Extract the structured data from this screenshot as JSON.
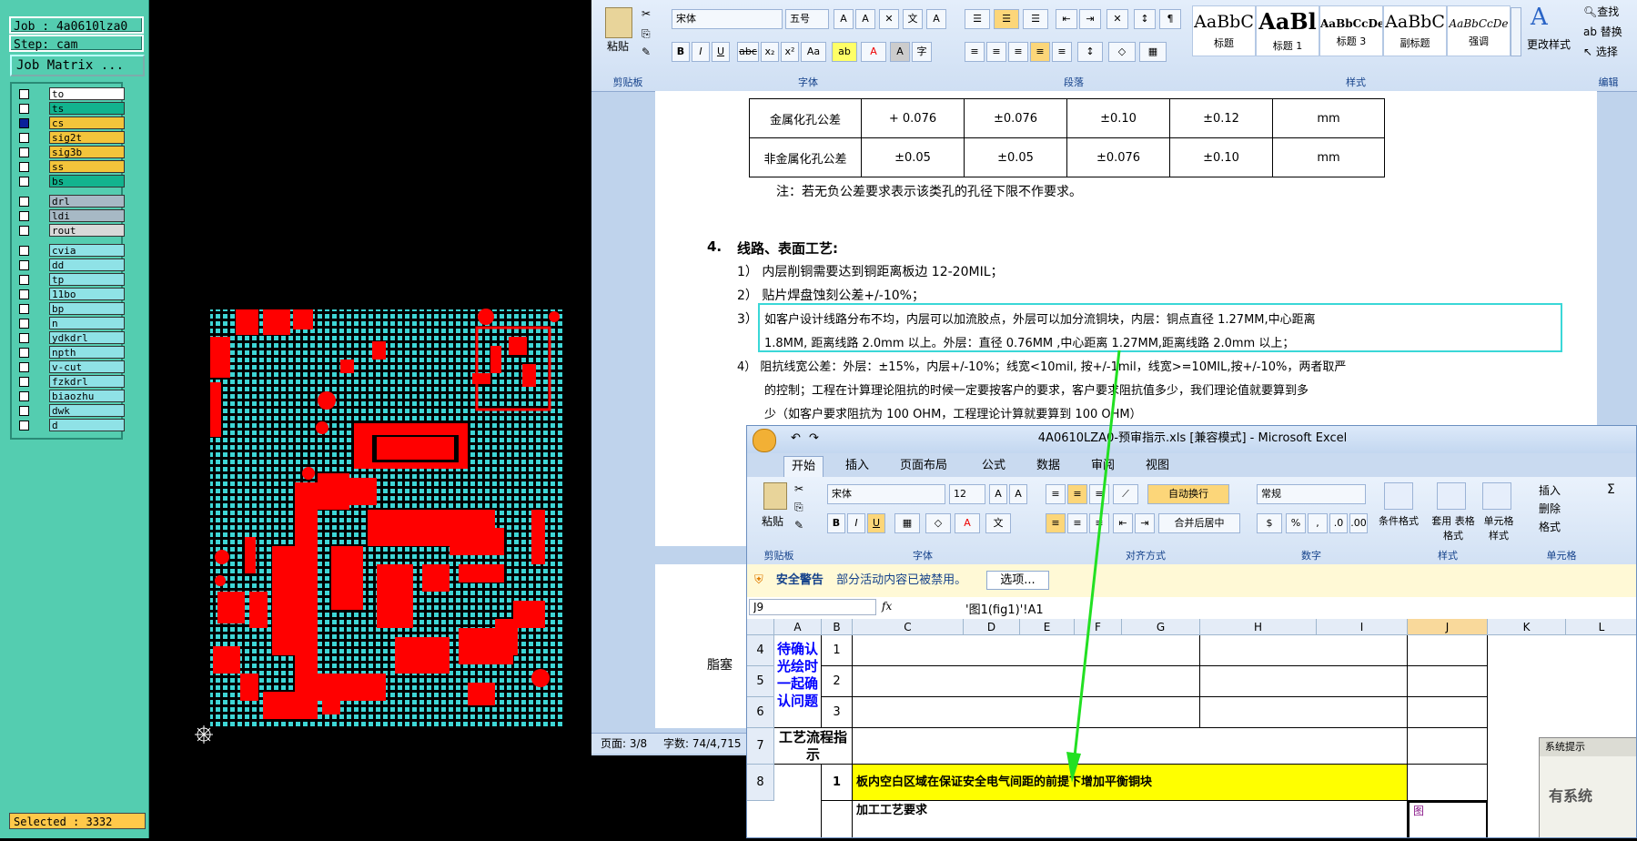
{
  "cam": {
    "job_label": "Job : 4a0610lza0",
    "step_label": "Step: cam",
    "job_matrix_button": "Job Matrix ...",
    "layers": [
      {
        "name": "to",
        "color": "#ffffff",
        "checked": false
      },
      {
        "name": "ts",
        "color": "#12b38e",
        "checked": false
      },
      {
        "name": "cs",
        "color": "#f3c43b",
        "checked": true
      },
      {
        "name": "sig2t",
        "color": "#f3c43b",
        "checked": false
      },
      {
        "name": "sig3b",
        "color": "#f3c43b",
        "checked": false
      },
      {
        "name": "ss",
        "color": "#f3c43b",
        "checked": false
      },
      {
        "name": "bs",
        "color": "#12b38e",
        "checked": false
      },
      {
        "name": "drl",
        "color": "#a7b9c5",
        "checked": false
      },
      {
        "name": "ldi",
        "color": "#a7b9c5",
        "checked": false
      },
      {
        "name": "rout",
        "color": "#d9d9d9",
        "checked": false
      },
      {
        "name": "cvia",
        "color": "#8fe2e6",
        "checked": false
      },
      {
        "name": "dd",
        "color": "#8fe2e6",
        "checked": false
      },
      {
        "name": "tp",
        "color": "#8fe2e6",
        "checked": false
      },
      {
        "name": "11bo",
        "color": "#8fe2e6",
        "checked": false
      },
      {
        "name": "bp",
        "color": "#8fe2e6",
        "checked": false
      },
      {
        "name": "n",
        "color": "#8fe2e6",
        "checked": false
      },
      {
        "name": "ydkdrl",
        "color": "#8fe2e6",
        "checked": false
      },
      {
        "name": "npth",
        "color": "#8fe2e6",
        "checked": false
      },
      {
        "name": "v-cut",
        "color": "#8fe2e6",
        "checked": false
      },
      {
        "name": "fzkdrl",
        "color": "#8fe2e6",
        "checked": false
      },
      {
        "name": "biaozhu",
        "color": "#8fe2e6",
        "checked": false
      },
      {
        "name": "dwk",
        "color": "#8fe2e6",
        "checked": false
      },
      {
        "name": "d",
        "color": "#8fe2e6",
        "checked": false
      }
    ],
    "selected_label": "Selected : 3332"
  },
  "word": {
    "ribbon": {
      "paste_label": "粘贴",
      "clipboard_group": "剪贴板",
      "font_name": "宋体",
      "font_size": "五号",
      "font_group": "字体",
      "paragraph_group": "段落",
      "styles_group": "样式",
      "editing_group": "编辑",
      "styles": [
        {
          "sample": "AaBbC",
          "label": "标题"
        },
        {
          "sample": "AaBl",
          "label": "标题 1"
        },
        {
          "sample": "AaBbCcDe",
          "label": "标题 3"
        },
        {
          "sample": "AaBbC",
          "label": "副标题"
        },
        {
          "sample": "AaBbCcDe",
          "label": "强调"
        }
      ],
      "change_styles": "更改样式",
      "find": "查找",
      "replace": "替换",
      "select": "选择"
    },
    "table_rows": [
      {
        "label": "金属化孔公差",
        "values": [
          "+ 0.076",
          "±0.076",
          "±0.10",
          "±0.12",
          "mm"
        ]
      },
      {
        "label": "非金属化孔公差",
        "values": [
          "±0.05",
          "±0.05",
          "±0.076",
          "±0.10",
          "mm"
        ]
      }
    ],
    "note": "注：若无负公差要求表示该类孔的孔径下限不作要求。",
    "section_num": "4.",
    "section_title": "线路、表面工艺:",
    "items": [
      "1） 内层削铜需要达到铜距离板边 12-20MIL；",
      "2） 贴片焊盘蚀刻公差+/-10%；",
      "3）"
    ],
    "item3_line1": "如客户设计线路分布不均，内层可以加流胶点，外层可以加分流铜块，内层：铜点直径 1.27MM,中心距离",
    "item3_line2": "1.8MM, 距离线路 2.0mm 以上。外层：直径 0.76MM ,中心距离 1.27MM,距离线路 2.0mm 以上；",
    "item4_line1": "4） 阻抗线宽公差：外层：±15%，内层+/-10%；线宽<10mil, 按+/-1mil，线宽>=10MIL,按+/-10%，两者取严",
    "item4_line2": "的控制；工程在计算理论阻抗的时候一定要按客户的要求，客户要求阻抗值多少，我们理论值就要算到多",
    "item4_line3": "少（如客户要求阻抗为 100 OHM，工程理论计算就要算到 100 OHM）",
    "page2_fragment": "脂塞",
    "status_page": "页面: 3/8",
    "status_words": "字数: 74/4,715"
  },
  "excel": {
    "title": "4A0610LZA0-预审指示.xls [兼容模式] - Microsoft Excel",
    "tabs": [
      "开始",
      "插入",
      "页面布局",
      "公式",
      "数据",
      "审阅",
      "视图"
    ],
    "ribbon": {
      "paste": "粘贴",
      "clipboard": "剪贴板",
      "font_name": "宋体",
      "font_size": "12",
      "font_group": "字体",
      "wrap_text": "自动换行",
      "merge_center": "合并后居中",
      "align_group": "对齐方式",
      "number_format": "常规",
      "number_group": "数字",
      "cond_format": "条件格式",
      "table_format": "套用 表格格式",
      "cell_style": "单元格 样式",
      "style_group": "样式",
      "insert": "插入",
      "delete": "删除",
      "format": "格式",
      "cells_group": "单元格",
      "sum": "Σ"
    },
    "security_label": "安全警告",
    "security_msg": "部分活动内容已被禁用。",
    "options_button": "选项...",
    "name_box": "J9",
    "formula": "'图1(fig1)'!A1",
    "columns": [
      "A",
      "B",
      "C",
      "D",
      "E",
      "F",
      "G",
      "H",
      "I",
      "J",
      "K",
      "L"
    ],
    "row_numbers": [
      "4",
      "5",
      "6",
      "7",
      "8"
    ],
    "confirm_label": "待确认光绘时一起确认问题",
    "sub_rows": [
      "1",
      "2",
      "3"
    ],
    "process_label": "工艺流程指示",
    "row8_num": "1",
    "row8_text": "板内空白区域在保证安全电气间距的前提下增加平衡铜块",
    "row9_text": "加工工艺要求",
    "j9_value": "图",
    "sys_prompt_title": "系统提示",
    "sys_prompt_text": "有系统"
  },
  "colors": {
    "cam_bg": "#54cdb0",
    "copper": "#ff0000",
    "pattern": "#3ed6d6",
    "highlight_box": "#3ad7d7",
    "arrow": "#22e022",
    "excel_yellow": "#ffff00"
  }
}
